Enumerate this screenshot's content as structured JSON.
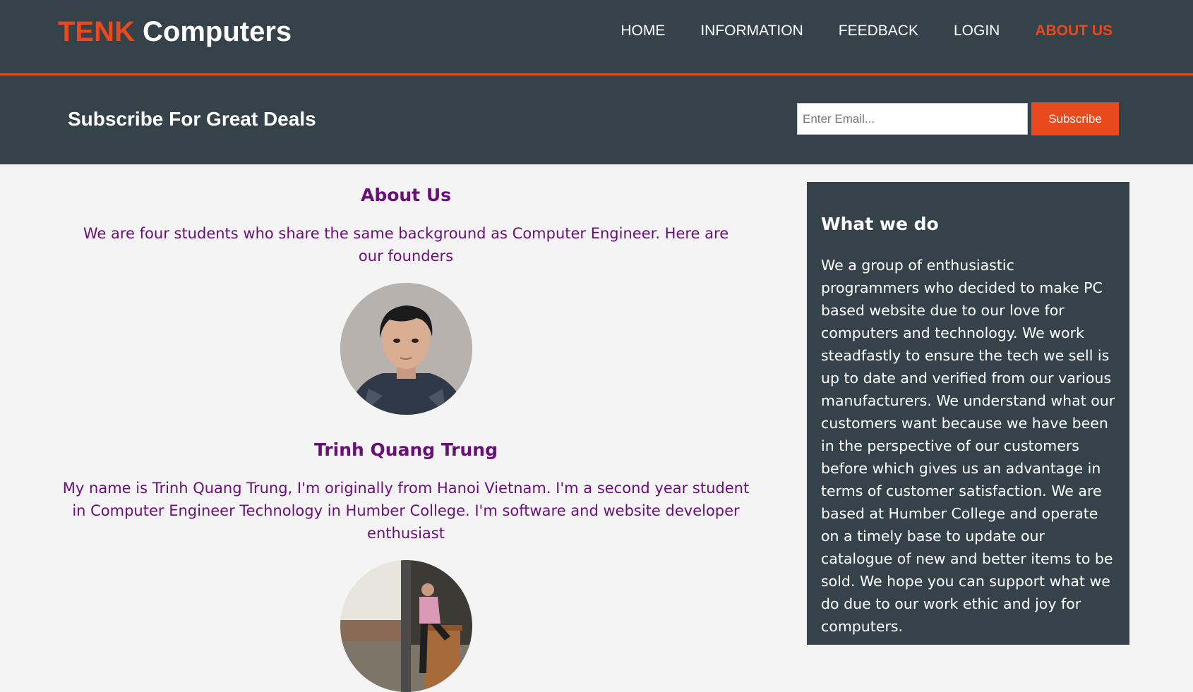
{
  "header": {
    "logo_highlight": "TENK",
    "logo_rest": "Computers",
    "nav": {
      "home": "HOME",
      "information": "INFORMATION",
      "feedback": "FEEDBACK",
      "login": "LOGIN",
      "about": "ABOUT US"
    },
    "current_nav": "ABOUT US"
  },
  "newsletter": {
    "title": "Subscribe For Great Deals",
    "email_placeholder": "Enter Email...",
    "subscribe_label": "Subscribe"
  },
  "main": {
    "heading": "About Us",
    "intro": "We are four students who share the same background as Computer Engineer. Here are our founders",
    "founders": [
      {
        "name": "Trinh Quang Trung",
        "bio": "My name is Trinh Quang Trung, I'm originally from Hanoi Vietnam. I'm a second year student in Computer Engineer Technology in Humber College. I'm software and website developer enthusiast"
      }
    ]
  },
  "sidebar": {
    "title": "What we do",
    "text": "We a group of enthusiastic programmers who decided to make PC based website due to our love for computers and technology. We work steadfastly to ensure the tech we sell is up to date and verified from our various manufacturers. We understand what our customers want because we have been in the perspective of our customers before which gives us an advantage in terms of customer satisfaction. We are based at Humber College and operate on a timely base to update our catalogue of new and better items to be sold. We hope you can support what we do due to our work ethic and joy for computers."
  },
  "colors": {
    "header_bg": "#35424a",
    "accent": "#e8491d",
    "body_bg": "#f4f4f4",
    "text_purple": "#6a0f7a"
  }
}
